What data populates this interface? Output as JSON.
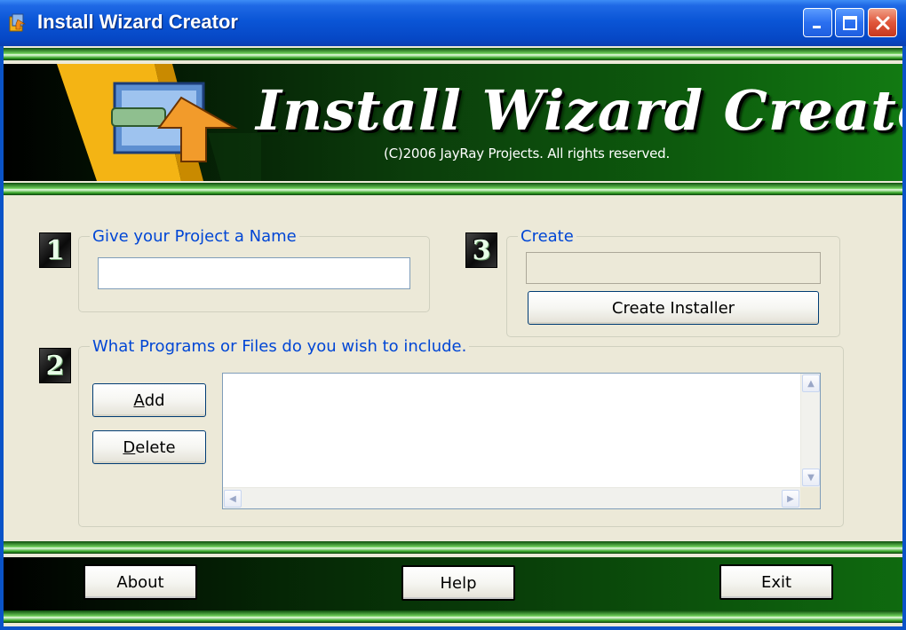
{
  "window": {
    "title": "Install Wizard Creator",
    "icons": [
      "app-icon",
      "minimize-icon",
      "maximize-icon",
      "close-icon"
    ]
  },
  "banner": {
    "title": "Install Wizard Creator",
    "copyright": "(C)2006  JayRay Projects.  All rights reserved."
  },
  "steps": {
    "one": {
      "number": "1",
      "legend": "Give your Project a Name",
      "input_value": ""
    },
    "two": {
      "number": "2",
      "legend": "What Programs or Files do you wish to include.",
      "add_accel": "A",
      "add_rest": "dd",
      "delete_accel": "D",
      "delete_rest": "elete",
      "files": []
    },
    "three": {
      "number": "3",
      "legend": "Create",
      "status_value": "",
      "create_label": "Create Installer"
    }
  },
  "bottom": {
    "about_label": "About",
    "help_label": "Help",
    "exit_label": "Exit"
  },
  "colors": {
    "title_blue": "#0a55d6",
    "legend_blue": "#0046d5",
    "banner_green": "#0d5a0d",
    "face": "#ece9d8"
  }
}
